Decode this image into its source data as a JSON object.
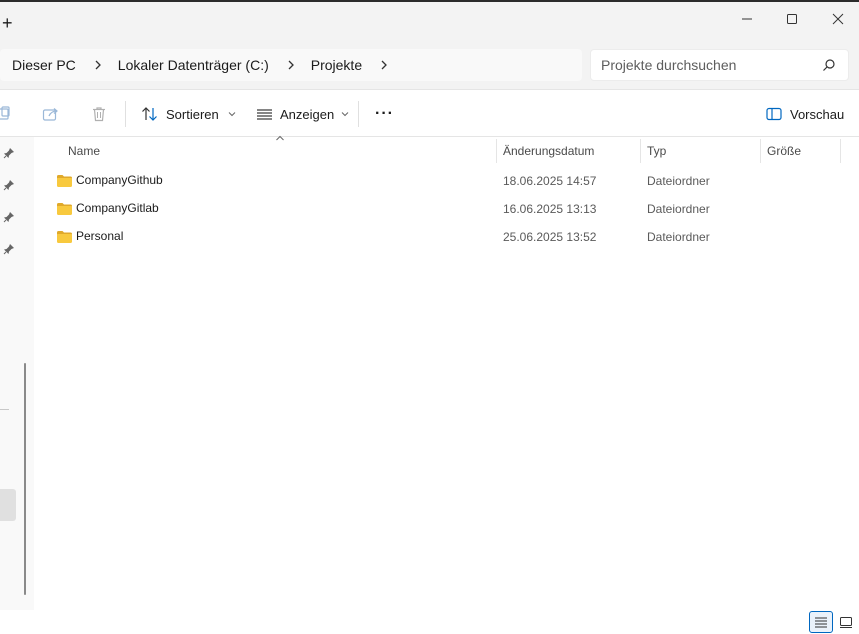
{
  "titlebar": {
    "new_tab_label": "+",
    "minimize_icon": "minimize-icon",
    "maximize_icon": "maximize-icon",
    "close_icon": "close-icon"
  },
  "address": {
    "crumbs": [
      "Dieser PC",
      "Lokaler Datenträger (C:)",
      "Projekte"
    ],
    "search_placeholder": "Projekte durchsuchen"
  },
  "toolbar": {
    "sort_label": "Sortieren",
    "view_label": "Anzeigen",
    "more_label": "···",
    "preview_label": "Vorschau"
  },
  "columns": {
    "name": "Name",
    "date": "Änderungsdatum",
    "type": "Typ",
    "size": "Größe"
  },
  "files": [
    {
      "name": "CompanyGithub",
      "date": "18.06.2025 14:57",
      "type": "Dateiordner",
      "size": ""
    },
    {
      "name": "CompanyGitlab",
      "date": "16.06.2025 13:13",
      "type": "Dateiordner",
      "size": ""
    },
    {
      "name": "Personal",
      "date": "25.06.2025 13:52",
      "type": "Dateiordner",
      "size": ""
    }
  ],
  "colors": {
    "accent": "#0067c0",
    "folder_yellow": "#f8c93e",
    "folder_dark": "#e0a92a"
  }
}
